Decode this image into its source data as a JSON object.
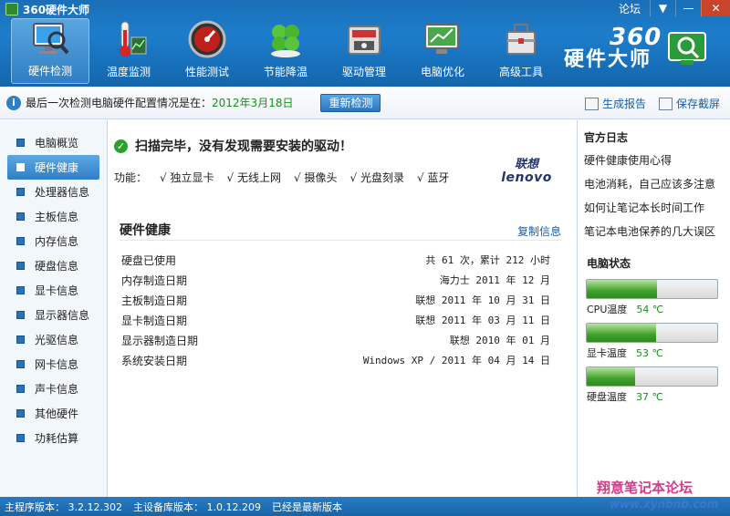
{
  "app": {
    "title": "360硬件大师",
    "forum_label": "论坛",
    "window_buttons": [
      "▼",
      "—",
      "✕"
    ]
  },
  "toolbar": [
    {
      "label": "硬件检测",
      "icon": "monitor-magnifier-icon",
      "active": true
    },
    {
      "label": "温度监测",
      "icon": "thermometer-icon",
      "active": false
    },
    {
      "label": "性能测试",
      "icon": "speedometer-icon",
      "active": false
    },
    {
      "label": "节能降温",
      "icon": "clover-icon",
      "active": false
    },
    {
      "label": "驱动管理",
      "icon": "driver-chip-icon",
      "active": false
    },
    {
      "label": "电脑优化",
      "icon": "optimize-monitor-icon",
      "active": false
    },
    {
      "label": "高级工具",
      "icon": "toolbox-icon",
      "active": false
    }
  ],
  "brand": {
    "line1": "360",
    "line2": "硬件大师"
  },
  "status": {
    "text": "最后一次检测电脑硬件配置情况是在：",
    "date": "2012年3月18日",
    "recheck_label": "重新检测",
    "report_label": "生成报告",
    "screenshot_label": "保存截屏"
  },
  "sidebar": {
    "items": [
      {
        "label": "电脑概览",
        "active": false
      },
      {
        "label": "硬件健康",
        "active": true
      },
      {
        "label": "处理器信息",
        "active": false
      },
      {
        "label": "主板信息",
        "active": false
      },
      {
        "label": "内存信息",
        "active": false
      },
      {
        "label": "硬盘信息",
        "active": false
      },
      {
        "label": "显卡信息",
        "active": false
      },
      {
        "label": "显示器信息",
        "active": false
      },
      {
        "label": "光驱信息",
        "active": false
      },
      {
        "label": "网卡信息",
        "active": false
      },
      {
        "label": "声卡信息",
        "active": false
      },
      {
        "label": "其他硬件",
        "active": false
      },
      {
        "label": "功耗估算",
        "active": false
      }
    ]
  },
  "main": {
    "scan_message": "扫描完毕，没有发现需要安装的驱动！",
    "features_label": "功能：",
    "features": [
      "独立显卡",
      "无线上网",
      "摄像头",
      "光盘刻录",
      "蓝牙"
    ],
    "vendor": {
      "cn": "联想",
      "en": "lenovo"
    },
    "health_title": "硬件健康",
    "copy_label": "复制信息",
    "health_rows": [
      {
        "label": "硬盘已使用",
        "value": "共 61 次，累计 212 小时"
      },
      {
        "label": "内存制造日期",
        "value": "海力士 2011 年 12 月"
      },
      {
        "label": "主板制造日期",
        "value": "联想 2011 年 10 月 31 日"
      },
      {
        "label": "显卡制造日期",
        "value": "联想 2011 年 03 月 11 日"
      },
      {
        "label": "显示器制造日期",
        "value": "联想 2010 年 01 月"
      },
      {
        "label": "系统安装日期",
        "value": "Windows XP / 2011 年 04 月 14 日"
      }
    ]
  },
  "right": {
    "log_title": "官方日志",
    "logs": [
      "硬件健康使用心得",
      "电池消耗，自己应该多注意",
      "如何让笔记本长时间工作",
      "笔记本电池保养的几大误区"
    ],
    "state_title": "电脑状态",
    "temps": [
      {
        "label": "CPU温度",
        "value": "54 ℃",
        "level": 0.54
      },
      {
        "label": "显卡温度",
        "value": "53 ℃",
        "level": 0.53
      },
      {
        "label": "硬盘温度",
        "value": "37 ℃",
        "level": 0.37
      }
    ]
  },
  "footer": {
    "program_version": "主程序版本： 3.2.12.302",
    "db_version": "主设备库版本： 1.0.12.209",
    "latest": "已经是最新版本"
  },
  "watermark": {
    "line1": "翔意笔记本论坛",
    "line2": "www.xynbnb.com"
  },
  "colors": {
    "header": "#1d7dcb",
    "accent_green": "#1a8f1a",
    "link": "#1a5fa8"
  }
}
